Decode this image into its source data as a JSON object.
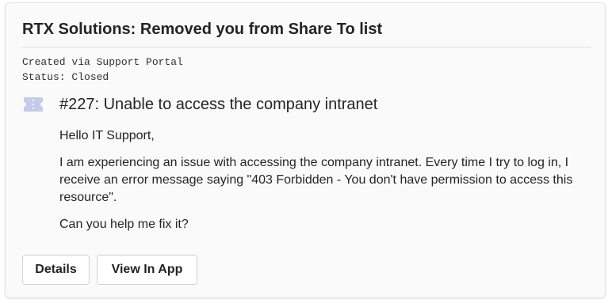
{
  "card": {
    "title": "RTX Solutions: Removed you from Share To list",
    "meta": {
      "created": "Created via Support Portal",
      "status": "Status: Closed"
    },
    "ticket": {
      "icon": "ticket-icon",
      "title": "#227: Unable to access the company intranet"
    },
    "body": {
      "greeting": "Hello IT Support,",
      "paragraph": "I am experiencing an issue with accessing the company intranet. Every time I try to log in, I receive an error message saying \"403 Forbidden - You don't have permission to access this resource\".",
      "question": "Can you help me fix it?"
    },
    "actions": {
      "details_label": "Details",
      "view_in_app_label": "View In App"
    }
  },
  "colors": {
    "card_background": "#fafafa",
    "text": "#242424",
    "icon": "#c5cbe8"
  }
}
